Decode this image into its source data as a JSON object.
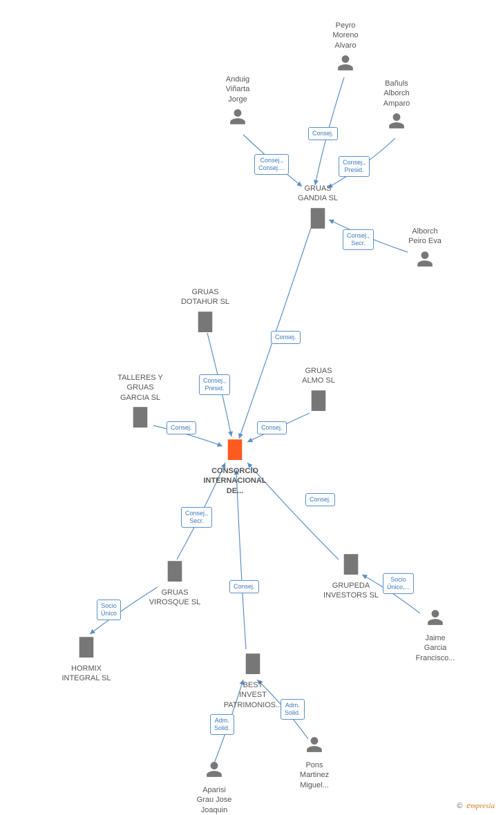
{
  "nodes": {
    "peyro": {
      "label": "Peyro\nMoreno\nAlvaro",
      "type": "person"
    },
    "anduig": {
      "label": "Anduig\nViñarta\nJorge",
      "type": "person"
    },
    "banuls": {
      "label": "Bañuls\nAlborch\nAmparo",
      "type": "person"
    },
    "alborch": {
      "label": "Alborch\nPeiro Eva",
      "type": "person"
    },
    "jaime": {
      "label": "Jaime\nGarcia\nFrancisco...",
      "type": "person"
    },
    "aparisi": {
      "label": "Aparisi\nGrau Jose\nJoaquin",
      "type": "person"
    },
    "pons": {
      "label": "Pons\nMartinez\nMiguel...",
      "type": "person"
    },
    "gruas_gandia": {
      "label": "GRUAS\nGANDIA SL",
      "type": "company"
    },
    "gruas_dotahur": {
      "label": "GRUAS\nDOTAHUR  SL",
      "type": "company"
    },
    "gruas_almo": {
      "label": "GRUAS\nALMO SL",
      "type": "company"
    },
    "talleres": {
      "label": "TALLERES Y\nGRUAS\nGARCIA SL",
      "type": "company"
    },
    "gruas_virosque": {
      "label": "GRUAS\nVIROSQUE SL",
      "type": "company"
    },
    "hormix": {
      "label": "HORMIX\nINTEGRAL SL",
      "type": "company"
    },
    "best_invest": {
      "label": "BEST\nINVEST\nPATRIMONIOS...",
      "type": "company"
    },
    "grupeda": {
      "label": "GRUPEDA\nINVESTORS SL",
      "type": "company"
    },
    "consorcio": {
      "label": "CONSORCIO\nINTERNACIONAL\nDE...",
      "type": "company_focus"
    }
  },
  "edges": {
    "peyro_gandia": "Consej.",
    "anduig_gandia": "Consej.,\nConsej....",
    "banuls_gandia": "Consej.,\nPresid.",
    "alborch_gandia": "Consej.,\nSecr.",
    "gandia_consorcio": "Consej.",
    "dotahur_consorcio": "Consej.,\nPresid.",
    "almo_consorcio": "Consej.",
    "talleres_consorcio": "Consej.",
    "virosque_consorcio": "Consej.,\nSecr.",
    "virosque_hormix": "Socio\nÚnico",
    "bestinvest_consorcio": "Consej.",
    "aparisi_bestinvest": "Adm.\nSolid.",
    "pons_bestinvest": "Adm.\nSolid.",
    "grupeda_consorcio": "Consej.",
    "jaime_grupeda": "Socio\nÚnico,..."
  },
  "footer": {
    "copyright": "©",
    "brand": "mpresia"
  }
}
